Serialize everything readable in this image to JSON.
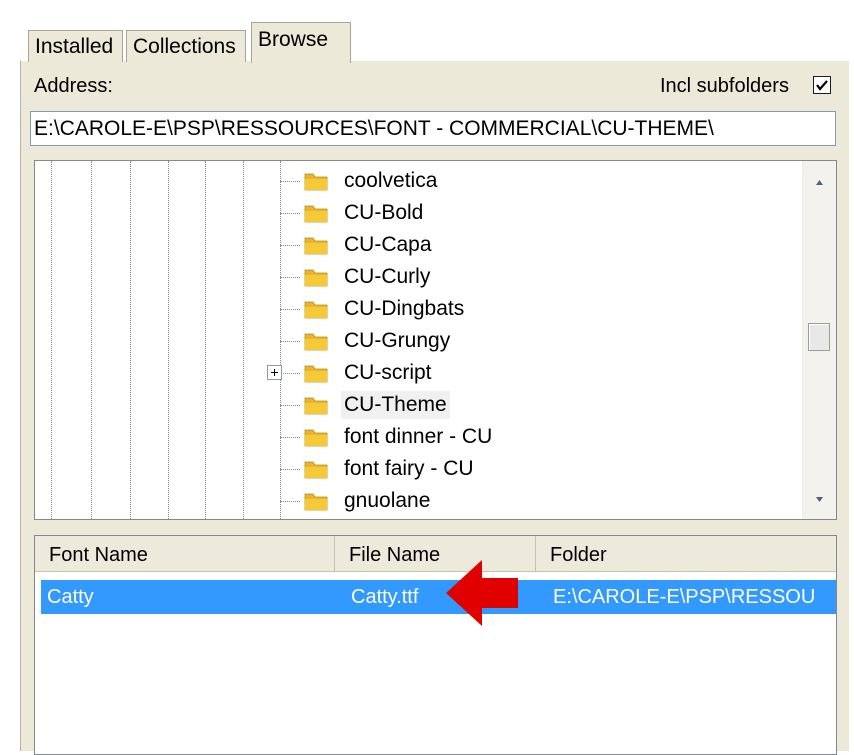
{
  "tabs": [
    {
      "label": "Installed",
      "active": false
    },
    {
      "label": "Collections",
      "active": false
    },
    {
      "label": "Browse",
      "active": true
    }
  ],
  "address": {
    "label": "Address:",
    "value": "E:\\CAROLE-E\\PSP\\RESSOURCES\\FONT - COMMERCIAL\\CU-THEME\\"
  },
  "incl_subfolders": {
    "label": "Incl subfolders",
    "checked": true
  },
  "tree": {
    "items": [
      {
        "label": "coolvetica",
        "icon": "folder-icon"
      },
      {
        "label": "CU-Bold",
        "icon": "folder-icon"
      },
      {
        "label": "CU-Capa",
        "icon": "folder-icon"
      },
      {
        "label": "CU-Curly",
        "icon": "folder-icon"
      },
      {
        "label": "CU-Dingbats",
        "icon": "folder-icon"
      },
      {
        "label": "CU-Grungy",
        "icon": "folder-icon"
      },
      {
        "label": "CU-script",
        "icon": "folder-icon",
        "expandable": true
      },
      {
        "label": "CU-Theme",
        "icon": "folder-icon",
        "selected": true
      },
      {
        "label": "font dinner - CU",
        "icon": "folder-icon"
      },
      {
        "label": "font fairy - CU",
        "icon": "folder-icon"
      },
      {
        "label": "gnuolane",
        "icon": "folder-icon"
      }
    ]
  },
  "font_list": {
    "columns": [
      "Font Name",
      "File Name",
      "Folder"
    ],
    "rows": [
      {
        "font_name": "Catty",
        "file_name": "Catty.ttf",
        "folder": "E:\\CAROLE-E\\PSP\\RESSOU",
        "selected": true
      }
    ]
  },
  "colors": {
    "selection": "#3399ff",
    "arrow": "#e00000",
    "folder": "#f5c93a"
  }
}
